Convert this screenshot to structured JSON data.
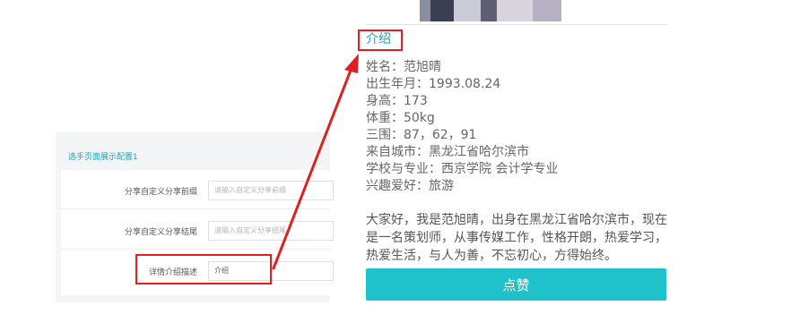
{
  "config": {
    "section_title": "选手页面展示配置1",
    "rows": [
      {
        "label": "分享自定义分享前缀",
        "placeholder": "请输入自定义分享前缀",
        "value": ""
      },
      {
        "label": "分享自定义分享结尾",
        "placeholder": "请输入自定义分享结尾",
        "value": ""
      },
      {
        "label": "详情介绍描述",
        "placeholder": "",
        "value": "介绍"
      }
    ]
  },
  "preview": {
    "intro_heading": "介绍",
    "info": [
      "姓名：范旭晴",
      "出生年月：1993.08.24",
      "身高：173",
      "体重：50kg",
      "三围：87，62，91",
      "来自城市：黑龙江省哈尔滨市",
      "学校与专业：西京学院 会计学专业",
      "兴趣爱好：旅游"
    ],
    "bio": [
      "大家好，我是范旭晴，出身在黑龙江省哈尔滨市，现在",
      "是一名策划师，从事传媒工作，性格开朗，热爱学习，",
      "热爱生活，与人为善，不忘初心，方得始终。"
    ],
    "like_button": "点赞"
  },
  "colors": {
    "accent": "#1aa7b5",
    "button": "#1fc2cb",
    "highlight": "#e02020"
  }
}
